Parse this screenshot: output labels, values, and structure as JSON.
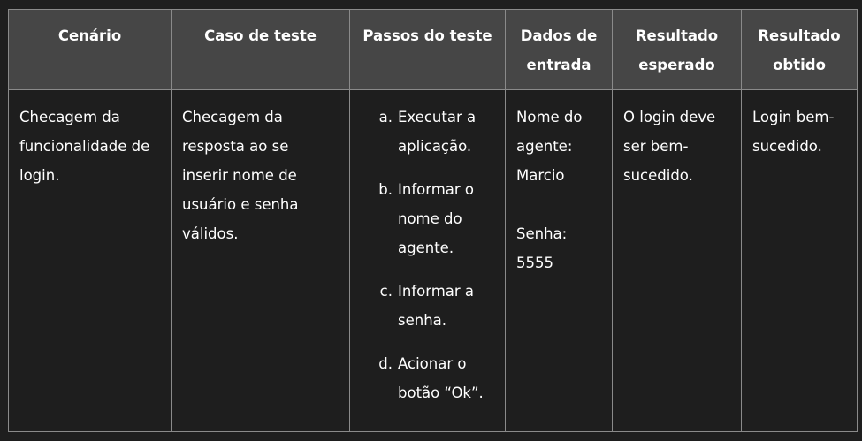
{
  "table": {
    "headers": [
      "Cenário",
      "Caso de teste",
      "Passos do teste",
      "Dados de entrada",
      "Resultado esperado",
      "Resultado obtido"
    ],
    "row": {
      "cenario": "Checagem da funcionalidade de login.",
      "caso": "Checagem da resposta ao se inserir nome de usuário e senha válidos.",
      "passos": [
        {
          "marker": "a.",
          "text": "Executar a aplicação."
        },
        {
          "marker": "b.",
          "text": "Informar o nome do agente."
        },
        {
          "marker": "c.",
          "text": "Informar a senha."
        },
        {
          "marker": "d.",
          "text": "Acionar o botão “Ok”."
        }
      ],
      "dados_nome": "Nome do agente: Marcio",
      "dados_senha": "Senha: 5555",
      "esperado": "O login deve ser bem-sucedido.",
      "obtido": "Login bem-sucedido."
    }
  }
}
